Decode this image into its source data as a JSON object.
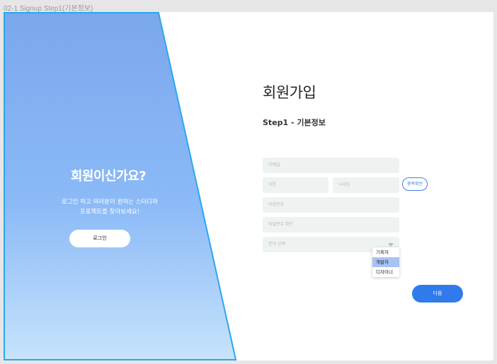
{
  "frame": {
    "label": "02-1 Signup Step1(기본정보)"
  },
  "hero": {
    "title": "회원이신가요?",
    "description_line1": "로그인 하고 여러분이 원하는 스터디와",
    "description_line2": "프로젝트를 찾아보세요!",
    "login_button": "로그인",
    "gradient_top": "#7ba7ec",
    "gradient_bottom": "#c7e3fc",
    "outline_color": "#2aa7f1"
  },
  "form": {
    "title": "회원가입",
    "subtitle": "Step1 - 기본정보",
    "email_placeholder": "이메일",
    "name_placeholder": "이름",
    "nickname_placeholder": "닉네임",
    "duplicate_check_button": "중복확인",
    "password_placeholder": "비밀번호",
    "password_confirm_placeholder": "비밀번호 확인",
    "field_select": {
      "placeholder": "분야 선택",
      "options": [
        "기획자",
        "개발자",
        "디자이너"
      ],
      "highlighted": "개발자"
    },
    "next_button": "다음",
    "accent_color": "#2f7bec"
  }
}
